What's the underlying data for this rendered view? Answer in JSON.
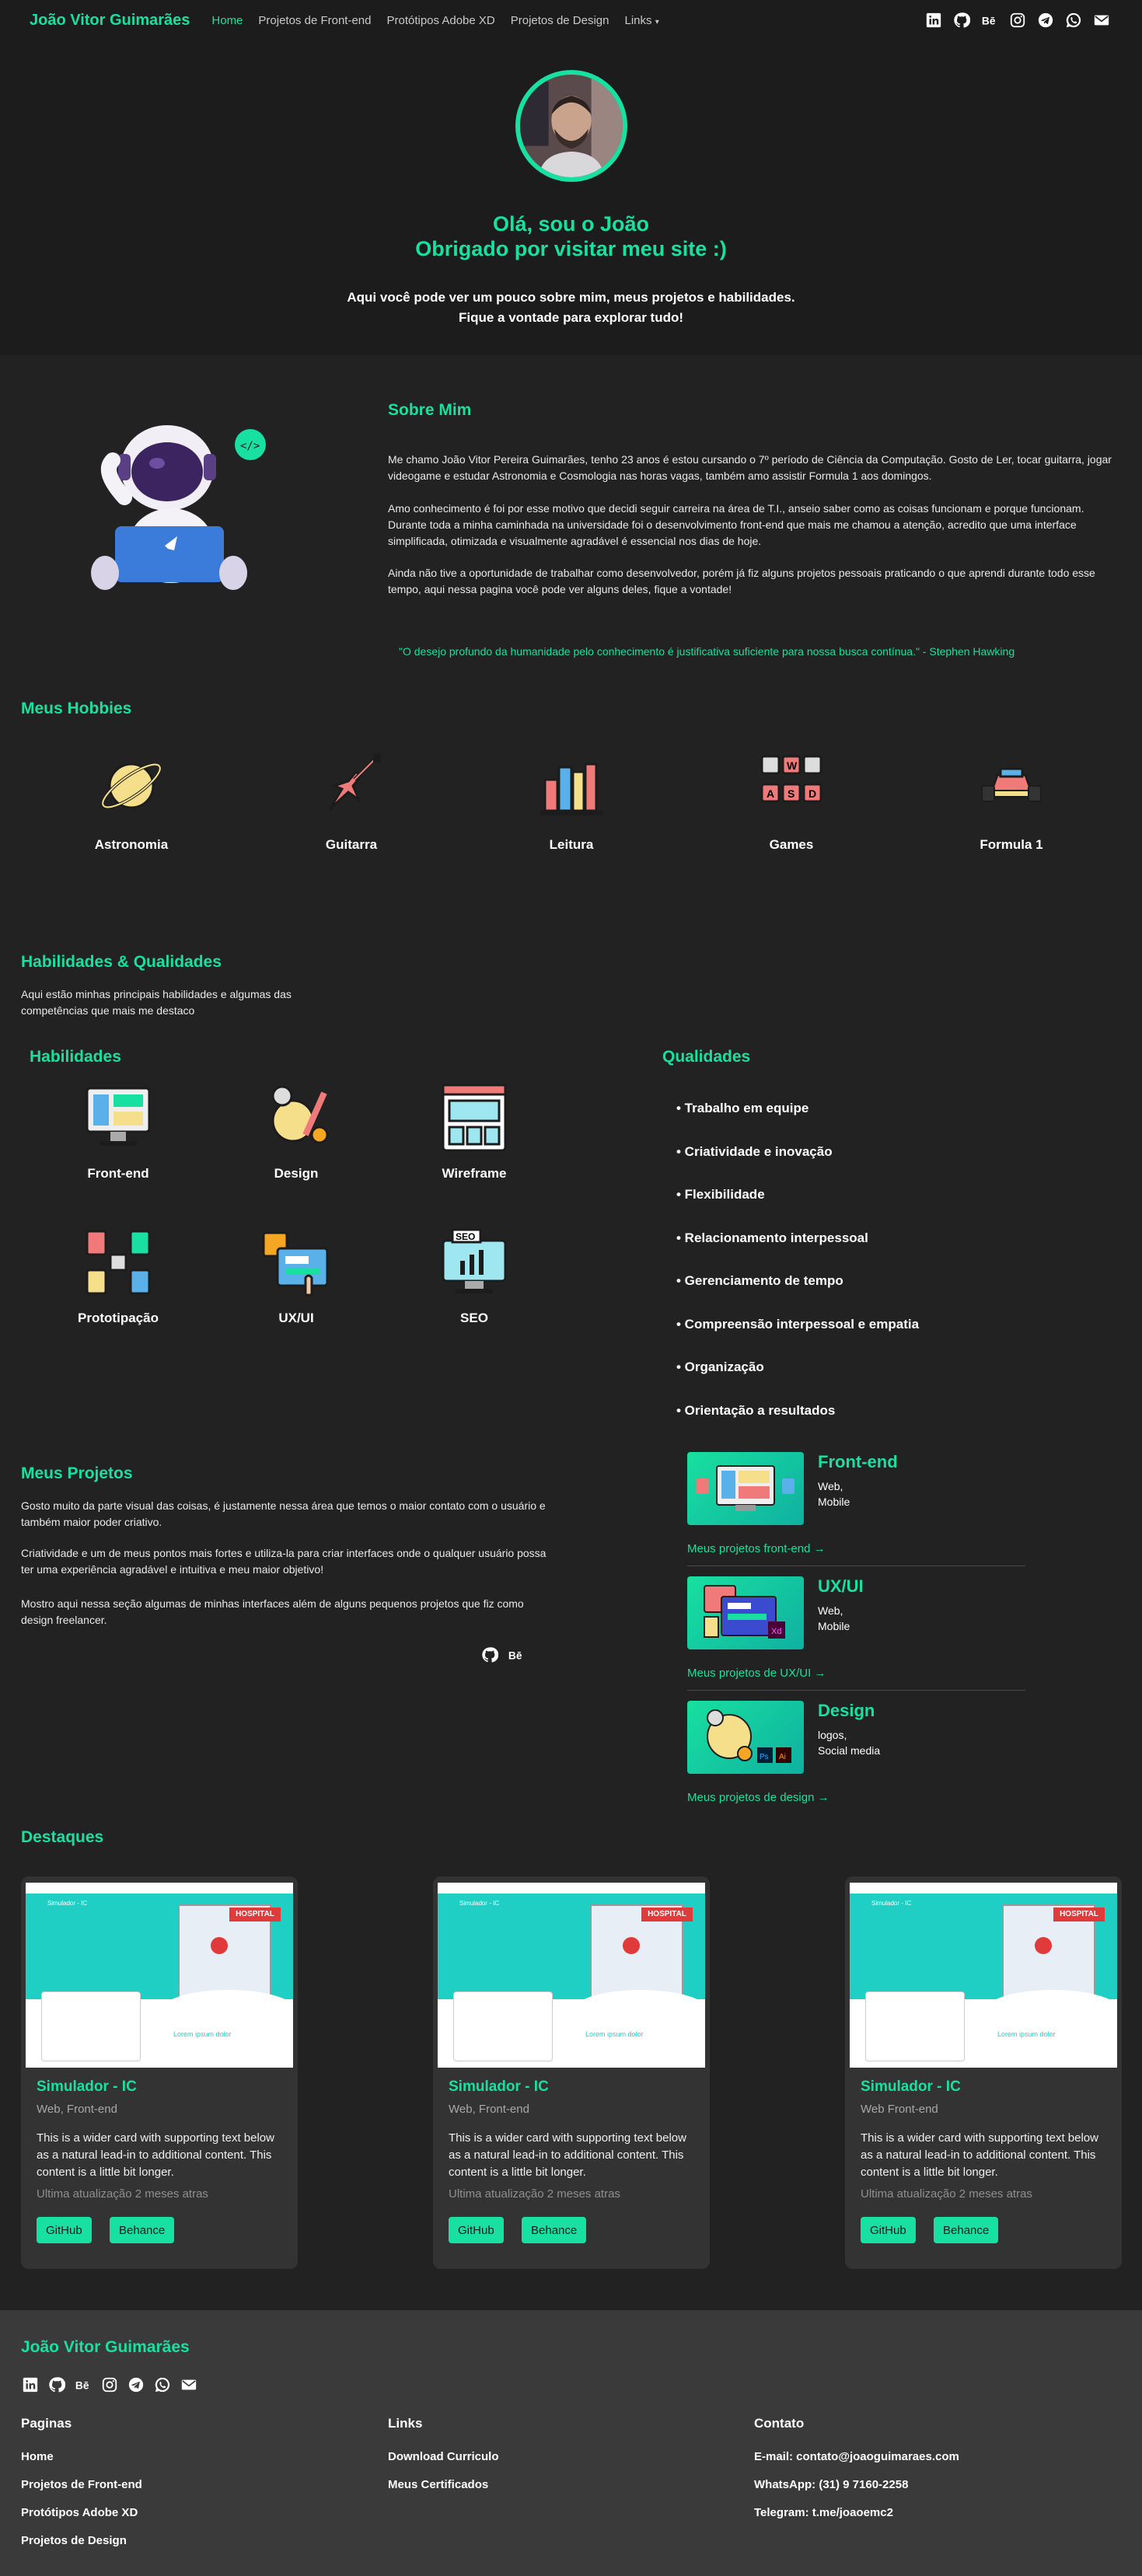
{
  "nav": {
    "brand": "João Vitor Guimarães",
    "links": [
      "Home",
      "Projetos de Front-end",
      "Protótipos Adobe XD",
      "Projetos de Design",
      "Links"
    ],
    "social_icons": [
      "linkedin-icon",
      "github-icon",
      "behance-icon",
      "instagram-icon",
      "telegram-icon",
      "whatsapp-icon",
      "email-icon"
    ]
  },
  "hero": {
    "title_line1": "Olá, sou o João",
    "title_line2": "Obrigado por visitar meu site :)",
    "subtitle_line1": "Aqui você pode ver um pouco sobre mim, meus projetos e habilidades.",
    "subtitle_line2": "Fique a vontade para explorar tudo!"
  },
  "sobre": {
    "title": "Sobre Mim",
    "p1": "Me chamo João Vitor Pereira Guimarães, tenho 23 anos é estou cursando o 7º período de Ciência da Computação. Gosto de Ler, tocar guitarra, jogar videogame e estudar Astronomia e Cosmologia nas horas vagas, também amo assistir Formula 1 aos domingos.",
    "p2": "Amo conhecimento é foi por esse motivo que decidi seguir carreira na área de T.I., anseio saber como as coisas funcionam e porque funcionam. Durante toda a minha caminhada na universidade foi o desenvolvimento front-end que mais me chamou a atenção, acredito que uma interface simplificada, otimizada e visualmente agradável é essencial nos dias de hoje.",
    "p3": "Ainda não tive a oportunidade de trabalhar como desenvolvedor, porém já fiz alguns projetos pessoais praticando o que aprendi durante todo esse tempo, aqui nessa pagina você pode ver alguns deles, fique a vontade!",
    "quote": "\"O desejo profundo da humanidade pelo conhecimento é justificativa suficiente para nossa busca contínua.\" - Stephen Hawking"
  },
  "hobbies": {
    "title": "Meus Hobbies",
    "items": [
      "Astronomia",
      "Guitarra",
      "Leitura",
      "Games",
      "Formula 1"
    ]
  },
  "habilidades": {
    "title": "Habilidades & Qualidades",
    "intro_line1": "Aqui estão minhas principais habilidades e algumas das",
    "intro_line2": "competências que mais me destaco",
    "skills_title": "Habilidades",
    "skills": [
      "Front-end",
      "Design",
      "Wireframe",
      "Prototipação",
      "UX/UI",
      "SEO"
    ],
    "qual_title": "Qualidades",
    "qualidades": [
      "• Trabalho em equipe",
      "• Criatividade e inovação",
      "• Flexibilidade",
      "• Relacionamento interpessoal",
      "• Gerenciamento de tempo",
      "• Compreensão interpessoal e empatia",
      "• Organização",
      "• Orientação a resultados"
    ]
  },
  "projetos": {
    "title": "Meus Projetos",
    "p1": "Gosto muito da parte visual das coisas, é justamente nessa área que temos o maior contato com o usuário e também maior poder criativo.",
    "p2": "Criatividade e um de meus pontos mais fortes e utiliza-la para criar interfaces onde o qualquer usuário possa ter uma experiência agradável e intuitiva e meu maior objetivo!",
    "p3": "Mostro aqui nessa seção algumas de minhas interfaces além de alguns pequenos projetos que fiz como design freelancer.",
    "cards": [
      {
        "title": "Front-end",
        "tag1": "Web,",
        "tag2": "Mobile",
        "link": "Meus projetos front-end"
      },
      {
        "title": "UX/UI",
        "tag1": "Web,",
        "tag2": "Mobile",
        "link": "Meus projetos de UX/UI"
      },
      {
        "title": "Design",
        "tag1": "logos,",
        "tag2": "Social media",
        "link": "Meus projetos de design"
      }
    ]
  },
  "destaques": {
    "title": "Destaques",
    "cards": [
      {
        "title": "Simulador - IC",
        "sub": "Web, Front-end",
        "desc": "This is a wider card with supporting text below as a natural lead-in to additional content. This content is a little bit longer.",
        "updated": "Ultima atualização 2 meses atras",
        "btn1": "GitHub",
        "btn2": "Behance"
      },
      {
        "title": "Simulador - IC",
        "sub": "Web, Front-end",
        "desc": "This is a wider card with supporting text below as a natural lead-in to additional content. This content is a little bit longer.",
        "updated": "Ultima atualização 2 meses atras",
        "btn1": "GitHub",
        "btn2": "Behance"
      },
      {
        "title": "Simulador - IC",
        "sub": "Web Front-end",
        "desc": "This is a wider card with supporting text below as a natural lead-in to additional content. This content is a little bit longer.",
        "updated": "Ultima atualização 2 meses atras",
        "btn1": "GitHub",
        "btn2": "Behance"
      }
    ],
    "mock": {
      "header": "Simulador - IC",
      "hospital": "HOSPITAL",
      "lorem": "Lorem ipsum dolor"
    }
  },
  "footer": {
    "brand": "João Vitor Guimarães",
    "paginas_title": "Paginas",
    "paginas": [
      "Home",
      "Projetos de Front-end",
      "Protótipos Adobe XD",
      "Projetos de Design"
    ],
    "links_title": "Links",
    "links": [
      "Download Curriculo",
      "Meus Certificados"
    ],
    "contato_title": "Contato",
    "contato": [
      "E-mail: contato@joaoguimaraes.com",
      "WhatsApp: (31) 9 7160-2258",
      "Telegram: t.me/joaoemc2"
    ]
  }
}
